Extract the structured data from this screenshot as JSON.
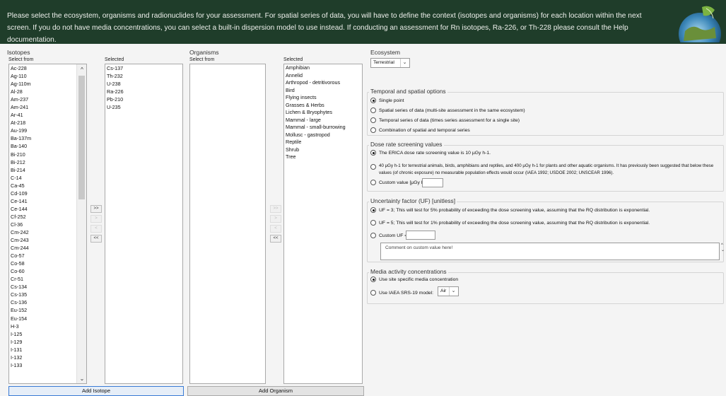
{
  "banner": {
    "text": "Please select the ecosystem, organisms and radionuclides for your assessment. For spatial series of data, you will have to define the context (isotopes and organisms) for each location within the next screen. If you do not have media concentrations, you can select a built-in dispersion model to use instead. If conducting an assessment for Rn isotopes, Ra-226, or Th-228 please consult the Help documentation."
  },
  "isotopes": {
    "title": "Isotopes",
    "select_from_label": "Select from",
    "selected_label": "Selected",
    "available": [
      "Ac-228",
      "Ag-110",
      "Ag-110m",
      "Al-28",
      "Am-237",
      "Am-241",
      "Ar-41",
      "At-218",
      "Au-199",
      "Ba-137m",
      "Ba-140",
      "Bi-210",
      "Bi-212",
      "Bi-214",
      "C-14",
      "Ca-45",
      "Cd-109",
      "Ce-141",
      "Ce-144",
      "Cf-252",
      "Cl-36",
      "Cm-242",
      "Cm-243",
      "Cm-244",
      "Co-57",
      "Co-58",
      "Co-60",
      "Cr-51",
      "Cs-134",
      "Cs-135",
      "Cs-136",
      "Eu-152",
      "Eu-154",
      "H-3",
      "I-125",
      "I-129",
      "I-131",
      "I-132",
      "I-133"
    ],
    "selected": [
      "Cs-137",
      "Th-232",
      "U-238",
      "Ra-226",
      "Pb-210",
      "U-235"
    ],
    "add_button": "Add Isotope",
    "move_buttons": [
      ">>",
      ">",
      "<",
      "<<"
    ]
  },
  "organisms": {
    "title": "Organisms",
    "select_from_label": "Select from",
    "selected_label": "Selected",
    "available": [],
    "selected": [
      "Amphibian",
      "Annelid",
      "Arthropod - detritivorous",
      "Bird",
      "Flying insects",
      "Grasses & Herbs",
      "Lichen & Bryophytes",
      "Mammal - large",
      "Mammal - small-burrowing",
      "Mollusc - gastropod",
      "Reptile",
      "Shrub",
      "Tree"
    ],
    "add_button": "Add Organism",
    "move_buttons": [
      ">>",
      ">",
      "<",
      "<<"
    ]
  },
  "ecosystem": {
    "title": "Ecosystem",
    "value": "Terrestrial"
  },
  "temporal": {
    "title": "Temporal and spatial options",
    "options": [
      {
        "label": "Single point",
        "checked": true
      },
      {
        "label": "Spatial series of data (multi-site assessment in the same ecosystem)",
        "checked": false
      },
      {
        "label": "Temporal series of data (times series assessment for a single site)",
        "checked": false
      },
      {
        "label": "Combination of spatial and temporal series",
        "checked": false
      }
    ]
  },
  "dose": {
    "title": "Dose rate screening values",
    "options": [
      {
        "label": "The ERICA dose rate screening value is 10 µGy h-1.",
        "checked": true
      },
      {
        "label": "40 µGy h-1 for terrestrial animals, birds, amphibians and reptiles, and 400 µGy h-1 for plants and other aquatic organisms. It has previously been suggested that below these values (of chronic exposure) no measurable population effects would occur (IAEA 1992; USDOE 2002; UNSCEAR 1996).",
        "checked": false
      },
      {
        "label": "Custom value [µGy h-1]:",
        "checked": false
      }
    ]
  },
  "uncertainty": {
    "title": "Uncertainty factor (UF) [unitless]",
    "options": [
      {
        "label": "UF = 3; This will test for 5% probability of exceeding the dose screening value, assuming that the RQ distribution is exponential.",
        "checked": true
      },
      {
        "label": "UF = 5; This will test for 1% probability of exceeding the dose screening value, assuming that the RQ distribution is exponential.",
        "checked": false
      },
      {
        "label": "Custom UF =",
        "checked": false
      }
    ],
    "comment_placeholder": "Comment on custom value here!"
  },
  "media": {
    "title": "Media activity concentrations",
    "options": [
      {
        "label": "Use site specific media concentration",
        "checked": true
      },
      {
        "label": "Use IAEA SRS-19 model:",
        "checked": false
      }
    ],
    "model_value": "Air"
  }
}
